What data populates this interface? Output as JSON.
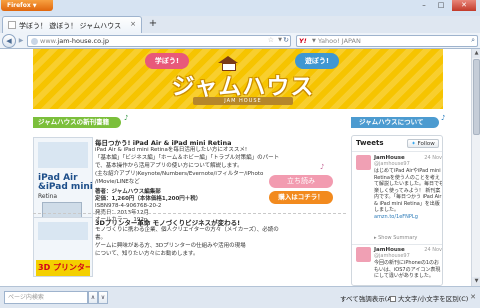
{
  "browser": {
    "app_button": "Firefox",
    "tab_title": "学ぼう！ 遊ぼう！ ジャムハウス",
    "url_host": "www.",
    "url_domain": "jam-house.co.jp",
    "search_engine": "Y!",
    "search_placeholder": "Yahoo! JAPAN",
    "new_tab": "+"
  },
  "banner": {
    "bubble_left": "学ぼう!",
    "bubble_right": "遊ぼう!",
    "title": "ジャムハウス",
    "sub_brand": "JAM HOUSE"
  },
  "sections": {
    "new_books": "ジャムハウスの新刊書籍",
    "about": "ジャムハウスについて"
  },
  "article1": {
    "cover_title_1": "iPad Air",
    "cover_title_2": "&iPad mini",
    "cover_sub": "Retina",
    "title": "毎日つかう! iPad Air & iPad mini Retina",
    "body": [
      "iPad Air & iPad mini Retinaを毎日活用したい方にオススメ!",
      "「基本編」「ビジネス編」「ホーム＆ホビー編」「トラブル対策編」のパート",
      "で、基本操作から活用アプリの使い方について解説します。",
      "(主な紹介アプリ)Keynote/Numbers/Evernote/iフィルター/iPhoto",
      "/iMovie/LINEなど"
    ],
    "author": "著者：ジャムハウス編集部",
    "price": "定価：1,260円（本体価格1,200円＋税）",
    "isbn": "ISBN978-4-906768-20-2",
    "release": "発売日：2013年12月",
    "color": "オールカラー　192p",
    "read_button": "立ち読み",
    "buy_button": "購入はコチラ！"
  },
  "article2": {
    "title": "3Dプリンター革命 モノづくりビジネスが変わる!",
    "body": [
      "モノづくりに携わる企業、個人クリエイターの方々（メイカーズ）、必読の",
      "書。",
      "ゲームに興味がある方、3Dプリンターの仕組みや活用の現場",
      "について、知りたい方々にお勧めします。"
    ],
    "cover_label": "3D プリンター"
  },
  "tweets": {
    "header": "Tweets",
    "follow": "Follow",
    "items": [
      {
        "user": "JamHouse",
        "handle": "@jamhouse97",
        "date": "24 Nov",
        "body": "はじめてiPad AirやiPad mini Retinaを使う人のことを考えて解説したいました。毎日でも楽しく使ってみよう！ 新刊案内です。「毎日つかう iPad Air & iPad mini Retina」を出版しました。",
        "link": "amzn.to/1eFNPLg",
        "summary": "Show Summary"
      },
      {
        "user": "JamHouse",
        "handle": "@jamhouse97",
        "date": "24 Nov",
        "body": "今回の新刊にiPhoneの1のおもいは、iOS7のアイコン表現にして違いがありました。"
      }
    ]
  },
  "findbar": {
    "placeholder": "ページ内検索",
    "highlight_all": "すべて強調表示(A)",
    "match_case": "大文字/小文字を区別(C)"
  },
  "colors": {
    "banner": "#f6c400",
    "section_green": "#7bbf3b",
    "section_blue": "#4c9bd0",
    "read_button": "#f29bb0",
    "buy_button": "#f28a1e"
  }
}
